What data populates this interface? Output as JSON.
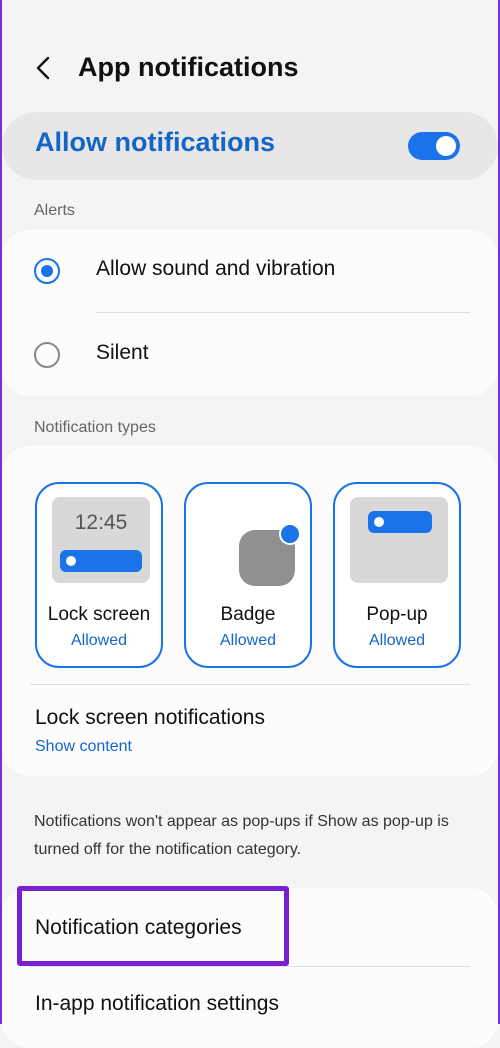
{
  "header": {
    "title": "App notifications"
  },
  "allow": {
    "label": "Allow notifications",
    "enabled": true
  },
  "alerts": {
    "section_label": "Alerts",
    "options": [
      {
        "label": "Allow sound and vibration",
        "selected": true
      },
      {
        "label": "Silent",
        "selected": false
      }
    ]
  },
  "types": {
    "section_label": "Notification types",
    "tiles": [
      {
        "name": "Lock screen",
        "status": "Allowed",
        "clock": "12:45"
      },
      {
        "name": "Badge",
        "status": "Allowed"
      },
      {
        "name": "Pop-up",
        "status": "Allowed"
      }
    ],
    "lock_screen_notifications": {
      "title": "Lock screen notifications",
      "value": "Show content"
    }
  },
  "info": {
    "text": "Notifications won't appear as pop-ups if Show as pop-up is turned off for the notification category."
  },
  "list": {
    "items": [
      {
        "label": "Notification categories"
      },
      {
        "label": "In-app notification settings"
      }
    ]
  },
  "colors": {
    "accent": "#1a73e8",
    "highlight": "#7a1fd1"
  }
}
